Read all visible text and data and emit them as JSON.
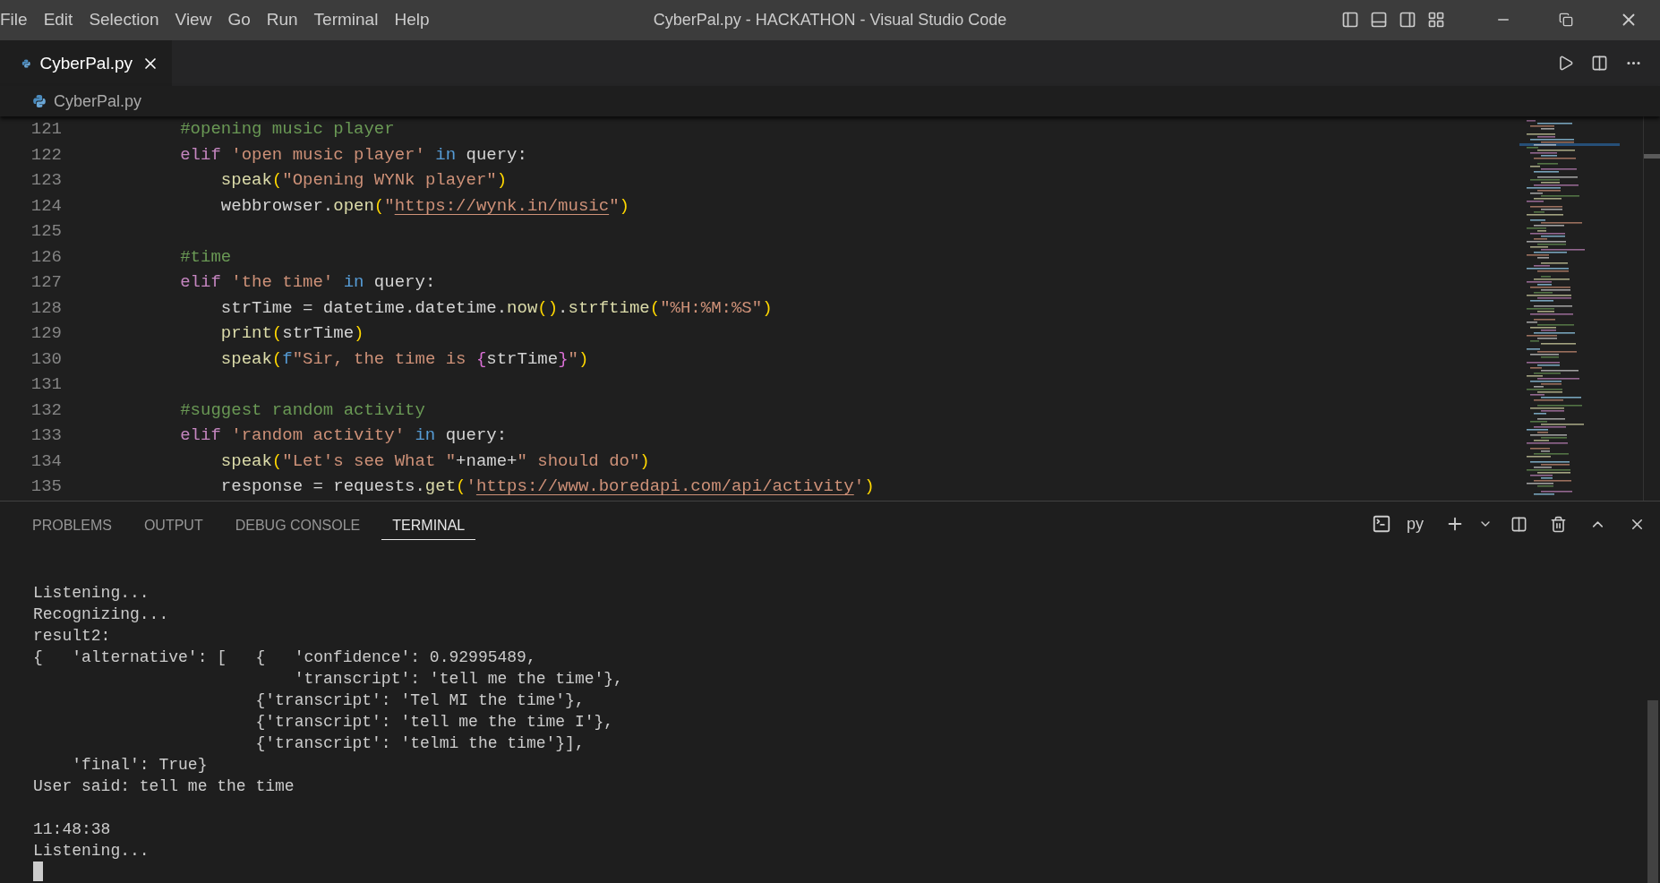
{
  "window": {
    "menu": [
      "File",
      "Edit",
      "Selection",
      "View",
      "Go",
      "Run",
      "Terminal",
      "Help"
    ],
    "title": "CyberPal.py - HACKATHON - Visual Studio Code"
  },
  "editor_tabs": [
    {
      "label": "CyberPal.py",
      "selected": true
    }
  ],
  "breadcrumb": "CyberPal.py",
  "code_lines": [
    {
      "number": "121",
      "tokens": [
        {
          "kind": "comment",
          "text": "        #opening music player"
        }
      ]
    },
    {
      "number": "122",
      "tokens": [
        {
          "kind": "keyword",
          "text": "        elif "
        },
        {
          "kind": "string",
          "text": "'open music player' "
        },
        {
          "kind": "operator",
          "text": "in"
        },
        {
          "kind": "plain",
          "text": " query:"
        }
      ]
    },
    {
      "number": "123",
      "tokens": [
        {
          "kind": "func",
          "text": "            speak"
        },
        {
          "kind": "bracket",
          "text": "("
        },
        {
          "kind": "string",
          "text": "\"Opening WYNk player\""
        },
        {
          "kind": "bracket",
          "text": ")"
        }
      ]
    },
    {
      "number": "124",
      "tokens": [
        {
          "kind": "plain",
          "text": "            webbrowser."
        },
        {
          "kind": "func",
          "text": "open"
        },
        {
          "kind": "bracket",
          "text": "("
        },
        {
          "kind": "string",
          "text": "\""
        },
        {
          "kind": "link",
          "text": "https://wynk.in/music"
        },
        {
          "kind": "string",
          "text": "\""
        },
        {
          "kind": "bracket",
          "text": ")"
        }
      ]
    },
    {
      "number": "125"
    },
    {
      "number": "126",
      "tokens": [
        {
          "kind": "comment",
          "text": "        #time"
        }
      ]
    },
    {
      "number": "127",
      "tokens": [
        {
          "kind": "keyword",
          "text": "        elif "
        },
        {
          "kind": "string",
          "text": "'the time' "
        },
        {
          "kind": "operator",
          "text": "in"
        },
        {
          "kind": "plain",
          "text": " query:"
        }
      ]
    },
    {
      "number": "128",
      "tokens": [
        {
          "kind": "plain",
          "text": "            strTime = datetime.datetime."
        },
        {
          "kind": "func",
          "text": "now"
        },
        {
          "kind": "bracket",
          "text": "()"
        },
        {
          "kind": "plain",
          "text": "."
        },
        {
          "kind": "func",
          "text": "strftime"
        },
        {
          "kind": "bracket",
          "text": "("
        },
        {
          "kind": "string",
          "text": "\"%H:%M:%S\""
        },
        {
          "kind": "bracket",
          "text": ")"
        }
      ]
    },
    {
      "number": "129",
      "tokens": [
        {
          "kind": "func",
          "text": "            print"
        },
        {
          "kind": "bracket",
          "text": "("
        },
        {
          "kind": "plain",
          "text": "strTime"
        },
        {
          "kind": "bracket",
          "text": ")"
        }
      ]
    },
    {
      "number": "130",
      "tokens": [
        {
          "kind": "func",
          "text": "            speak"
        },
        {
          "kind": "bracket",
          "text": "("
        },
        {
          "kind": "operator",
          "text": "f"
        },
        {
          "kind": "string",
          "text": "\"Sir, the time is "
        },
        {
          "kind": "brace",
          "text": "{"
        },
        {
          "kind": "plain",
          "text": "strTime"
        },
        {
          "kind": "brace",
          "text": "}"
        },
        {
          "kind": "string",
          "text": "\""
        },
        {
          "kind": "bracket",
          "text": ")"
        }
      ]
    },
    {
      "number": "131"
    },
    {
      "number": "132",
      "tokens": [
        {
          "kind": "comment",
          "text": "        #suggest random activity"
        }
      ]
    },
    {
      "number": "133",
      "tokens": [
        {
          "kind": "keyword",
          "text": "        elif "
        },
        {
          "kind": "string",
          "text": "'random activity' "
        },
        {
          "kind": "operator",
          "text": "in"
        },
        {
          "kind": "plain",
          "text": " query:"
        }
      ]
    },
    {
      "number": "134",
      "tokens": [
        {
          "kind": "func",
          "text": "            speak"
        },
        {
          "kind": "bracket",
          "text": "("
        },
        {
          "kind": "string",
          "text": "\"Let's see What \""
        },
        {
          "kind": "plain",
          "text": "+name+"
        },
        {
          "kind": "string",
          "text": "\" should do\""
        },
        {
          "kind": "bracket",
          "text": ")"
        }
      ]
    },
    {
      "number": "135",
      "tokens": [
        {
          "kind": "plain",
          "text": "            response = requests."
        },
        {
          "kind": "func",
          "text": "get"
        },
        {
          "kind": "bracket",
          "text": "("
        },
        {
          "kind": "string",
          "text": "'"
        },
        {
          "kind": "link",
          "text": "https://www.boredapi.com/api/activity"
        },
        {
          "kind": "string",
          "text": "'"
        },
        {
          "kind": "bracket",
          "text": ")"
        }
      ]
    }
  ],
  "panel_tabs": [
    {
      "label": "PROBLEMS",
      "selected": false
    },
    {
      "label": "OUTPUT",
      "selected": false
    },
    {
      "label": "DEBUG CONSOLE",
      "selected": false
    },
    {
      "label": "TERMINAL",
      "selected": true
    }
  ],
  "terminal_name": "py",
  "terminal_lines": [
    {
      "kind": "blank"
    },
    {
      "kind": "text",
      "text": "Listening..."
    },
    {
      "kind": "text",
      "text": "Recognizing..."
    },
    {
      "kind": "text",
      "text": "result2:"
    },
    {
      "kind": "text",
      "text": "{   'alternative': [   {   'confidence': 0.92995489,"
    },
    {
      "kind": "text",
      "text": "                           'transcript': 'tell me the time'},"
    },
    {
      "kind": "text",
      "text": "                       {'transcript': 'Tel MI the time'},"
    },
    {
      "kind": "text",
      "text": "                       {'transcript': 'tell me the time I'},"
    },
    {
      "kind": "text",
      "text": "                       {'transcript': 'telmi the time'}],"
    },
    {
      "kind": "text",
      "text": "    'final': True}"
    },
    {
      "kind": "text",
      "text": "User said: tell me the time"
    },
    {
      "kind": "blank"
    },
    {
      "kind": "text",
      "text": "11:48:38"
    },
    {
      "kind": "text",
      "text": "Listening..."
    },
    {
      "kind": "cursor"
    }
  ]
}
